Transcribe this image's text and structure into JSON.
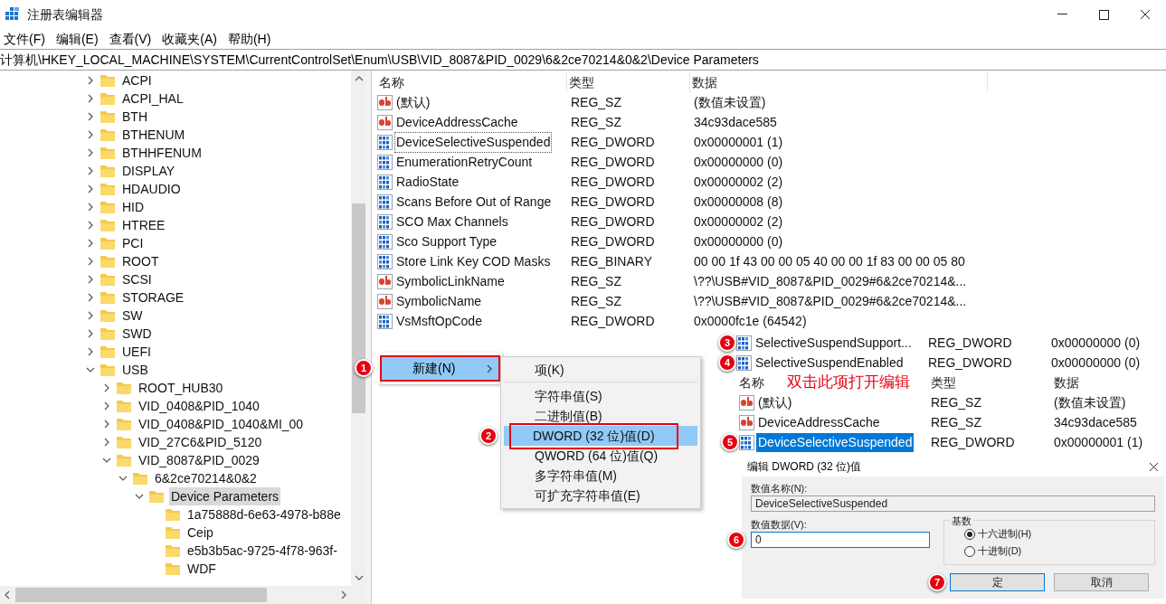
{
  "window": {
    "title": "注册表编辑器"
  },
  "menu": [
    "文件(F)",
    "编辑(E)",
    "查看(V)",
    "收藏夹(A)",
    "帮助(H)"
  ],
  "address": "计算机\\HKEY_LOCAL_MACHINE\\SYSTEM\\CurrentControlSet\\Enum\\USB\\VID_8087&PID_0029\\6&2ce70214&0&2\\Device Parameters",
  "tree": [
    {
      "label": "ACPI",
      "expanded": false,
      "selected": false
    },
    {
      "label": "ACPI_HAL",
      "expanded": false,
      "selected": false
    },
    {
      "label": "BTH",
      "expanded": false,
      "selected": false
    },
    {
      "label": "BTHENUM",
      "expanded": false,
      "selected": false
    },
    {
      "label": "BTHHFENUM",
      "expanded": false,
      "selected": false
    },
    {
      "label": "DISPLAY",
      "expanded": false,
      "selected": false
    },
    {
      "label": "HDAUDIO",
      "expanded": false,
      "selected": false
    },
    {
      "label": "HID",
      "expanded": false,
      "selected": false
    },
    {
      "label": "HTREE",
      "expanded": false,
      "selected": false
    },
    {
      "label": "PCI",
      "expanded": false,
      "selected": false
    },
    {
      "label": "ROOT",
      "expanded": false,
      "selected": false
    },
    {
      "label": "SCSI",
      "expanded": false,
      "selected": false
    },
    {
      "label": "STORAGE",
      "expanded": false,
      "selected": false
    },
    {
      "label": "SW",
      "expanded": false,
      "selected": false
    },
    {
      "label": "SWD",
      "expanded": false,
      "selected": false
    },
    {
      "label": "UEFI",
      "expanded": false,
      "selected": false
    },
    {
      "label": "USB",
      "expanded": true,
      "selected": false,
      "children": [
        {
          "label": "ROOT_HUB30",
          "expanded": false,
          "selected": false
        },
        {
          "label": "VID_0408&PID_1040",
          "expanded": false,
          "selected": false
        },
        {
          "label": "VID_0408&PID_1040&MI_00",
          "expanded": false,
          "selected": false
        },
        {
          "label": "VID_27C6&PID_5120",
          "expanded": false,
          "selected": false
        },
        {
          "label": "VID_8087&PID_0029",
          "expanded": true,
          "selected": false,
          "children": [
            {
              "label": "6&2ce70214&0&2",
              "expanded": true,
              "selected": false,
              "children": [
                {
                  "label": "Device Parameters",
                  "expanded": true,
                  "selected": true,
                  "children": [
                    {
                      "label": "1a75888d-6e63-4978-b88e",
                      "selected": false
                    },
                    {
                      "label": "Ceip",
                      "selected": false
                    },
                    {
                      "label": "e5b3b5ac-9725-4f78-963f-",
                      "selected": false
                    },
                    {
                      "label": "WDF",
                      "selected": false
                    }
                  ]
                }
              ]
            }
          ]
        }
      ]
    }
  ],
  "values": {
    "columns": [
      "名称",
      "类型",
      "数据"
    ],
    "rows": [
      {
        "kind": "string",
        "name": "(默认)",
        "type": "REG_SZ",
        "data": "(数值未设置)",
        "focused": false
      },
      {
        "kind": "string",
        "name": "DeviceAddressCache",
        "type": "REG_SZ",
        "data": "34c93dace585",
        "focused": false
      },
      {
        "kind": "dword",
        "name": "DeviceSelectiveSuspended",
        "type": "REG_DWORD",
        "data": "0x00000001 (1)",
        "focused": true
      },
      {
        "kind": "dword",
        "name": "EnumerationRetryCount",
        "type": "REG_DWORD",
        "data": "0x00000000 (0)",
        "focused": false
      },
      {
        "kind": "dword",
        "name": "RadioState",
        "type": "REG_DWORD",
        "data": "0x00000002 (2)",
        "focused": false
      },
      {
        "kind": "dword",
        "name": "Scans Before Out of Range",
        "type": "REG_DWORD",
        "data": "0x00000008 (8)",
        "focused": false
      },
      {
        "kind": "dword",
        "name": "SCO Max Channels",
        "type": "REG_DWORD",
        "data": "0x00000002 (2)",
        "focused": false
      },
      {
        "kind": "dword",
        "name": "Sco Support Type",
        "type": "REG_DWORD",
        "data": "0x00000000 (0)",
        "focused": false
      },
      {
        "kind": "dword",
        "name": "Store Link Key COD Masks",
        "type": "REG_BINARY",
        "data": "00 00 1f 43 00 00 05 40 00 00 1f 83 00 00 05 80",
        "focused": false
      },
      {
        "kind": "string",
        "name": "SymbolicLinkName",
        "type": "REG_SZ",
        "data": "\\??\\USB#VID_8087&PID_0029#6&2ce70214&...",
        "focused": false
      },
      {
        "kind": "string",
        "name": "SymbolicName",
        "type": "REG_SZ",
        "data": "\\??\\USB#VID_8087&PID_0029#6&2ce70214&...",
        "focused": false
      },
      {
        "kind": "dword",
        "name": "VsMsftOpCode",
        "type": "REG_DWORD",
        "data": "0x0000fc1e (64542)",
        "focused": false
      }
    ]
  },
  "context_menu": {
    "step": "1",
    "item": {
      "label": "新建(N)",
      "selected": true,
      "outlined": true
    },
    "submenu": [
      [
        {
          "label": "项(K)",
          "selected": false,
          "outlined": false
        }
      ],
      [
        {
          "label": "字符串值(S)",
          "selected": false,
          "outlined": false
        },
        {
          "label": "二进制值(B)",
          "selected": false,
          "outlined": false
        },
        {
          "label": "DWORD (32 位)值(D)",
          "selected": true,
          "outlined": true,
          "step": "2"
        },
        {
          "label": "QWORD (64 位)值(Q)",
          "selected": false,
          "outlined": false
        },
        {
          "label": "多字符串值(M)",
          "selected": false,
          "outlined": false
        },
        {
          "label": "可扩充字符串值(E)",
          "selected": false,
          "outlined": false
        }
      ]
    ]
  },
  "inset": {
    "rows_before": [
      {
        "kind": "dword",
        "step": "3",
        "name": "SelectiveSuspendSupport...",
        "type": "REG_DWORD",
        "data": "0x00000000 (0)"
      },
      {
        "kind": "dword",
        "step": "4",
        "name": "SelectiveSuspendEnabled",
        "type": "REG_DWORD",
        "data": "0x00000000 (0)"
      }
    ],
    "columns": [
      "名称",
      "类型",
      "数据"
    ],
    "rows": [
      {
        "kind": "string",
        "name": "(默认)",
        "type": "REG_SZ",
        "data": "(数值未设置)",
        "selected": false
      },
      {
        "kind": "string",
        "name": "DeviceAddressCache",
        "type": "REG_SZ",
        "data": "34c93dace585",
        "selected": false
      },
      {
        "kind": "dword",
        "step": "5",
        "name": "DeviceSelectiveSuspended",
        "type": "REG_DWORD",
        "data": "0x00000001 (1)",
        "selected": true
      }
    ],
    "annotation": "双击此项打开编辑"
  },
  "dialog": {
    "title": "编辑 DWORD (32 位)值",
    "name_label": "数值名称(N):",
    "name_value": "DeviceSelectiveSuspended",
    "data_label": "数值数据(V):",
    "data_value": "0",
    "data_step": "6",
    "base_label": "基数",
    "radios": [
      {
        "label": "十六进制(H)",
        "selected": true
      },
      {
        "label": "十进制(D)",
        "selected": false
      }
    ],
    "buttons": [
      {
        "label": "定",
        "step": "7"
      },
      {
        "label": "取消"
      }
    ]
  }
}
